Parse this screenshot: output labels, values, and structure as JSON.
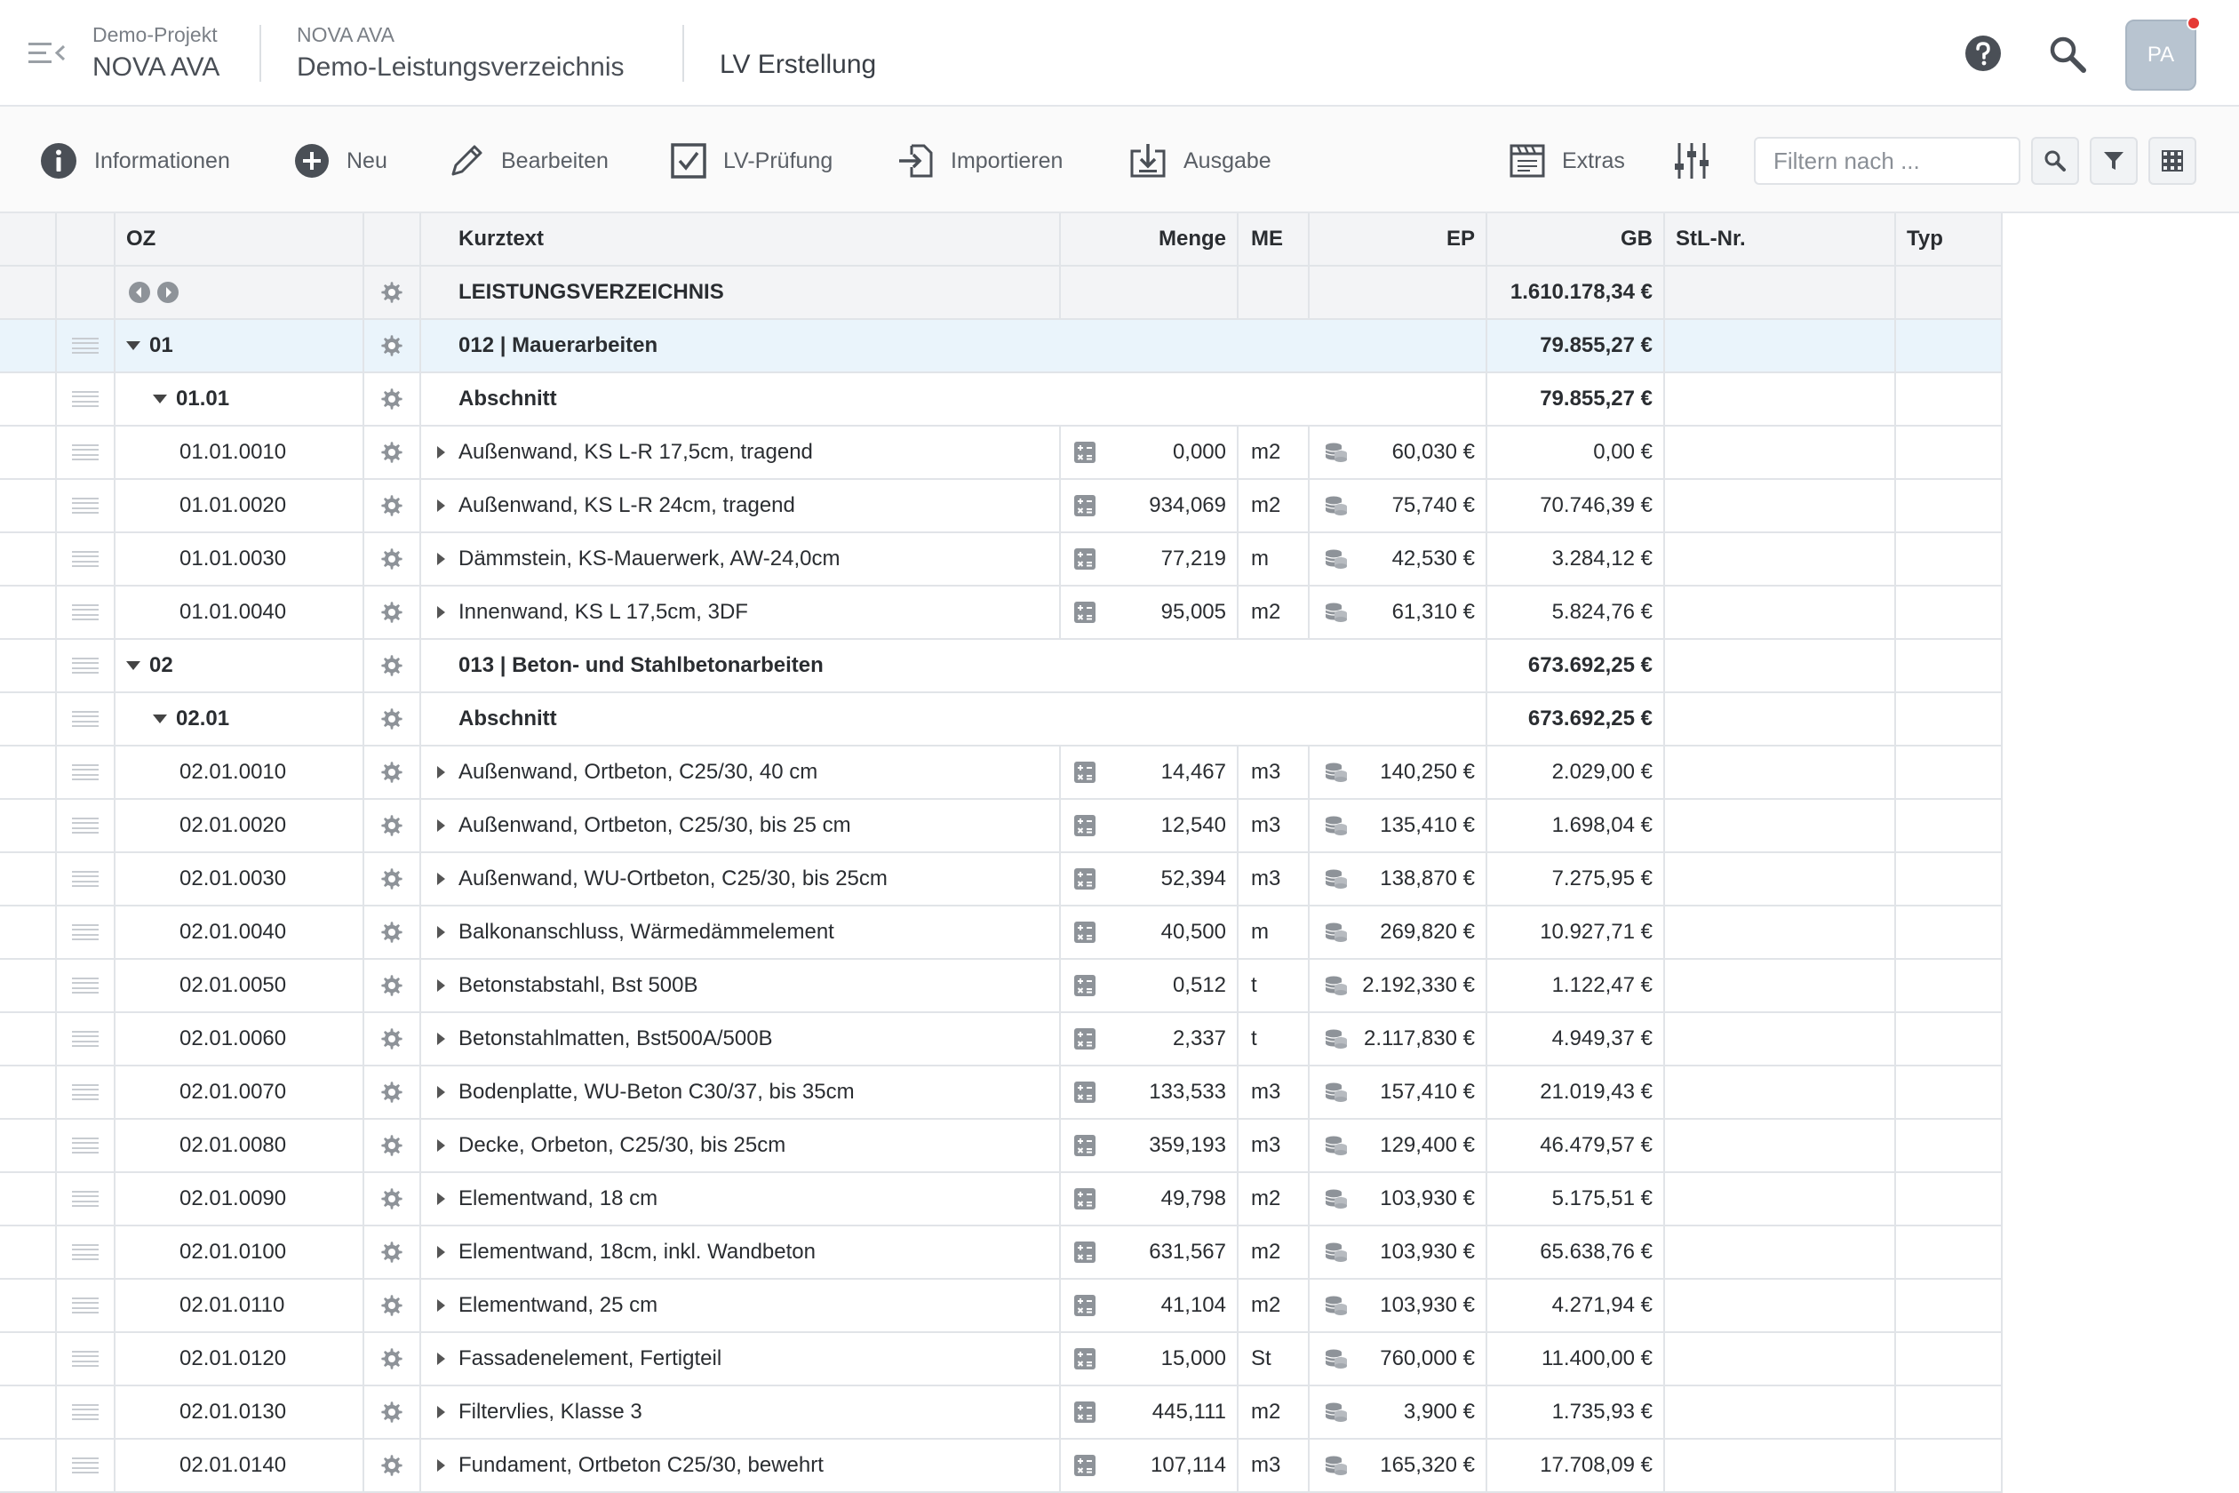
{
  "header": {
    "project_label": "Demo-Projekt",
    "project_name": "NOVA AVA",
    "lv_label": "NOVA AVA",
    "lv_name": "Demo-Leistungsverzeichnis",
    "mode": "LV Erstellung",
    "avatar_initials": "PA"
  },
  "toolbar": {
    "info": "Informationen",
    "new": "Neu",
    "edit": "Bearbeiten",
    "check": "LV-Prüfung",
    "import": "Importieren",
    "output": "Ausgabe",
    "extras": "Extras",
    "filter_placeholder": "Filtern nach ..."
  },
  "columns": {
    "oz": "OZ",
    "kurztext": "Kurztext",
    "menge": "Menge",
    "me": "ME",
    "ep": "EP",
    "gb": "GB",
    "stl": "StL-Nr.",
    "typ": "Typ"
  },
  "root": {
    "label": "LEISTUNGSVERZEICHNIS",
    "gb": "1.610.178,34 €"
  },
  "rows": [
    {
      "kind": "lot",
      "level": 0,
      "oz": "01",
      "text": "012 | Mauerarbeiten",
      "gb": "79.855,27 €"
    },
    {
      "kind": "section",
      "level": 1,
      "oz": "01.01",
      "text": "Abschnitt",
      "gb": "79.855,27 €"
    },
    {
      "kind": "pos",
      "oz": "01.01.0010",
      "text": "Außenwand, KS L-R 17,5cm, tragend",
      "menge": "0,000",
      "me": "m2",
      "ep": "60,030 €",
      "gb": "0,00 €"
    },
    {
      "kind": "pos",
      "oz": "01.01.0020",
      "text": "Außenwand, KS L-R 24cm, tragend",
      "menge": "934,069",
      "me": "m2",
      "ep": "75,740 €",
      "gb": "70.746,39 €"
    },
    {
      "kind": "pos",
      "oz": "01.01.0030",
      "text": "Dämmstein, KS-Mauerwerk, AW-24,0cm",
      "menge": "77,219",
      "me": "m",
      "ep": "42,530 €",
      "gb": "3.284,12 €"
    },
    {
      "kind": "pos",
      "oz": "01.01.0040",
      "text": "Innenwand, KS L 17,5cm, 3DF",
      "menge": "95,005",
      "me": "m2",
      "ep": "61,310 €",
      "gb": "5.824,76 €"
    },
    {
      "kind": "group",
      "level": 0,
      "oz": "02",
      "text": "013 | Beton- und Stahlbetonarbeiten",
      "gb": "673.692,25 €"
    },
    {
      "kind": "section",
      "level": 1,
      "oz": "02.01",
      "text": "Abschnitt",
      "gb": "673.692,25 €"
    },
    {
      "kind": "pos",
      "oz": "02.01.0010",
      "text": "Außenwand, Ortbeton, C25/30, 40 cm",
      "menge": "14,467",
      "me": "m3",
      "ep": "140,250 €",
      "gb": "2.029,00 €"
    },
    {
      "kind": "pos",
      "oz": "02.01.0020",
      "text": "Außenwand, Ortbeton, C25/30, bis 25 cm",
      "menge": "12,540",
      "me": "m3",
      "ep": "135,410 €",
      "gb": "1.698,04 €"
    },
    {
      "kind": "pos",
      "oz": "02.01.0030",
      "text": "Außenwand, WU-Ortbeton, C25/30, bis 25cm",
      "menge": "52,394",
      "me": "m3",
      "ep": "138,870 €",
      "gb": "7.275,95 €"
    },
    {
      "kind": "pos",
      "oz": "02.01.0040",
      "text": "Balkonanschluss, Wärmedämmelement",
      "menge": "40,500",
      "me": "m",
      "ep": "269,820 €",
      "gb": "10.927,71 €"
    },
    {
      "kind": "pos",
      "oz": "02.01.0050",
      "text": "Betonstabstahl, Bst 500B",
      "menge": "0,512",
      "me": "t",
      "ep": "2.192,330 €",
      "gb": "1.122,47 €"
    },
    {
      "kind": "pos",
      "oz": "02.01.0060",
      "text": "Betonstahlmatten, Bst500A/500B",
      "menge": "2,337",
      "me": "t",
      "ep": "2.117,830 €",
      "gb": "4.949,37 €"
    },
    {
      "kind": "pos",
      "oz": "02.01.0070",
      "text": "Bodenplatte, WU-Beton C30/37, bis 35cm",
      "menge": "133,533",
      "me": "m3",
      "ep": "157,410 €",
      "gb": "21.019,43 €"
    },
    {
      "kind": "pos",
      "oz": "02.01.0080",
      "text": "Decke, Orbeton, C25/30, bis 25cm",
      "menge": "359,193",
      "me": "m3",
      "ep": "129,400 €",
      "gb": "46.479,57 €"
    },
    {
      "kind": "pos",
      "oz": "02.01.0090",
      "text": "Elementwand, 18 cm",
      "menge": "49,798",
      "me": "m2",
      "ep": "103,930 €",
      "gb": "5.175,51 €"
    },
    {
      "kind": "pos",
      "oz": "02.01.0100",
      "text": "Elementwand, 18cm, inkl. Wandbeton",
      "menge": "631,567",
      "me": "m2",
      "ep": "103,930 €",
      "gb": "65.638,76 €"
    },
    {
      "kind": "pos",
      "oz": "02.01.0110",
      "text": "Elementwand, 25 cm",
      "menge": "41,104",
      "me": "m2",
      "ep": "103,930 €",
      "gb": "4.271,94 €"
    },
    {
      "kind": "pos",
      "oz": "02.01.0120",
      "text": "Fassadenelement, Fertigteil",
      "menge": "15,000",
      "me": "St",
      "ep": "760,000 €",
      "gb": "11.400,00 €"
    },
    {
      "kind": "pos",
      "oz": "02.01.0130",
      "text": "Filtervlies, Klasse 3",
      "menge": "445,111",
      "me": "m2",
      "ep": "3,900 €",
      "gb": "1.735,93 €"
    },
    {
      "kind": "pos",
      "oz": "02.01.0140",
      "text": "Fundament, Ortbeton C25/30, bewehrt",
      "menge": "107,114",
      "me": "m3",
      "ep": "165,320 €",
      "gb": "17.708,09 €"
    }
  ]
}
